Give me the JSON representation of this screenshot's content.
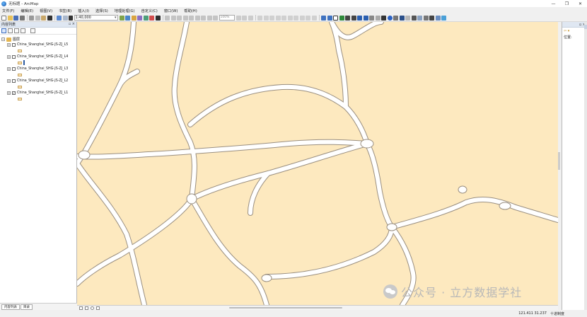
{
  "window": {
    "title": "无标题 - ArcMap",
    "controls": [
      "—",
      "❐",
      "✕"
    ]
  },
  "menu": {
    "items": [
      "文件(F)",
      "编辑(E)",
      "视图(V)",
      "书签(B)",
      "插入(I)",
      "选择(S)",
      "地理处理(G)",
      "自定义(C)",
      "窗口(W)",
      "帮助(H)"
    ]
  },
  "toolbar": {
    "scale": "1:40,000",
    "zoom_percent": "100%"
  },
  "toc": {
    "title": "内容列表",
    "header_buttons": "▫ ×",
    "frame_name": "图层",
    "layers": [
      {
        "label": "China_Shanghai_SHG-JS-ZJ_L5",
        "checked": false
      },
      {
        "label": "China_Shanghai_SHG-JS-ZJ_L4",
        "checked": false
      },
      {
        "label": "China_Shanghai_SHG-JS-ZJ_L3",
        "checked": false
      },
      {
        "label": "China_Shanghai_SHG-JS-ZJ_L2",
        "checked": false
      },
      {
        "label": "China_Shanghai_SHG-JS-ZJ_L1",
        "checked": true
      }
    ],
    "tabs": [
      "内容列表",
      "目录"
    ]
  },
  "right_panel": {
    "header_buttons": "▫ ×",
    "nav": "⇦ ▾",
    "label": "位置:"
  },
  "status": {
    "coordinates": "121.411  31.237",
    "units": "十进制度"
  },
  "watermark": {
    "text": "公众号 · 立方数据学社"
  },
  "colors": {
    "map_background": "#fde9bf",
    "road_fill": "#ffffff",
    "road_outline": "#9a8f80"
  }
}
